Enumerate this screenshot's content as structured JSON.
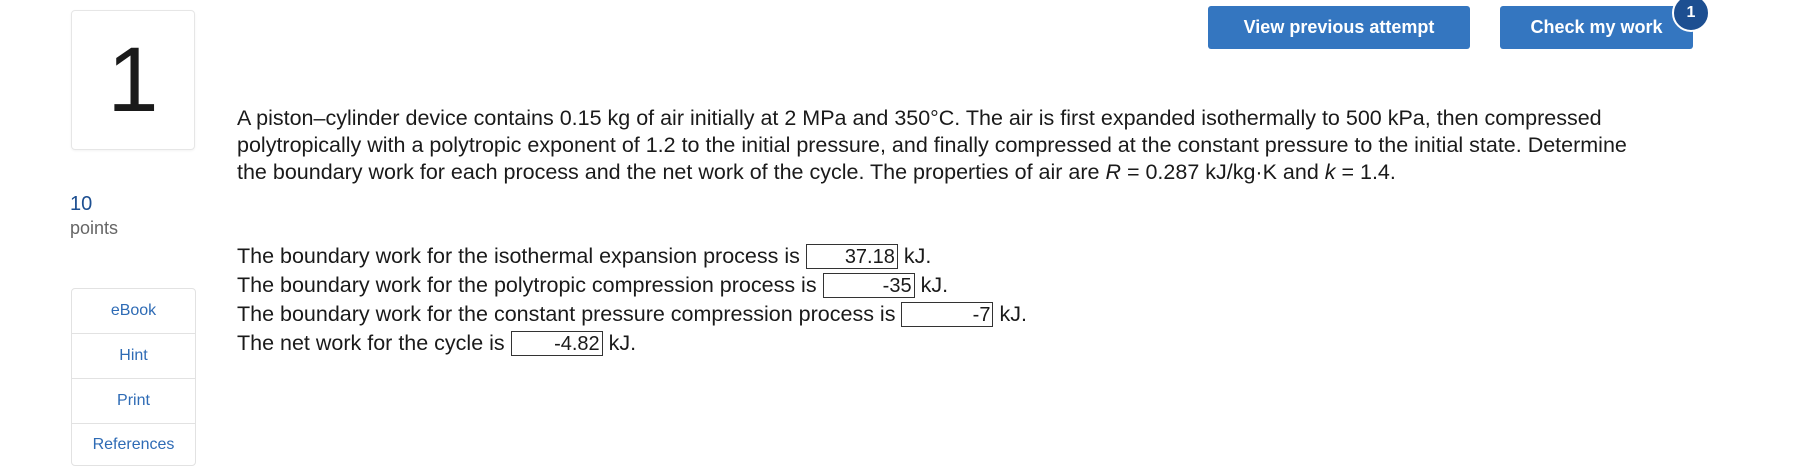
{
  "question": {
    "number": "1",
    "points_value": "10",
    "points_label": "points"
  },
  "tools": [
    "eBook",
    "Hint",
    "Print",
    "References"
  ],
  "buttons": {
    "view_previous": "View previous attempt",
    "check_work": "Check my work",
    "check_badge": "1"
  },
  "problem": {
    "text_1": "A piston–cylinder device contains 0.15 kg of air initially at 2 MPa and 350°C. The air is first expanded isothermally to 500 kPa, then compressed polytropically with a polytropic exponent of 1.2 to the initial pressure, and finally compressed at the constant pressure to the initial state. Determine the boundary work for each process and the net work of the cycle. The properties of air are ",
    "var_r": "R",
    "text_2": " = 0.287 kJ/kg·K and ",
    "var_k": "k",
    "text_3": " = 1.4."
  },
  "answers": [
    {
      "label": "The boundary work for the isothermal expansion process is",
      "value": "37.18",
      "unit": "kJ."
    },
    {
      "label": "The boundary work for the polytropic compression process is",
      "value": "-35",
      "unit": "kJ."
    },
    {
      "label": "The boundary work for the constant pressure compression process is",
      "value": "-7",
      "unit": "kJ."
    },
    {
      "label": "The net work for the cycle is",
      "value": "-4.82",
      "unit": "kJ."
    }
  ]
}
